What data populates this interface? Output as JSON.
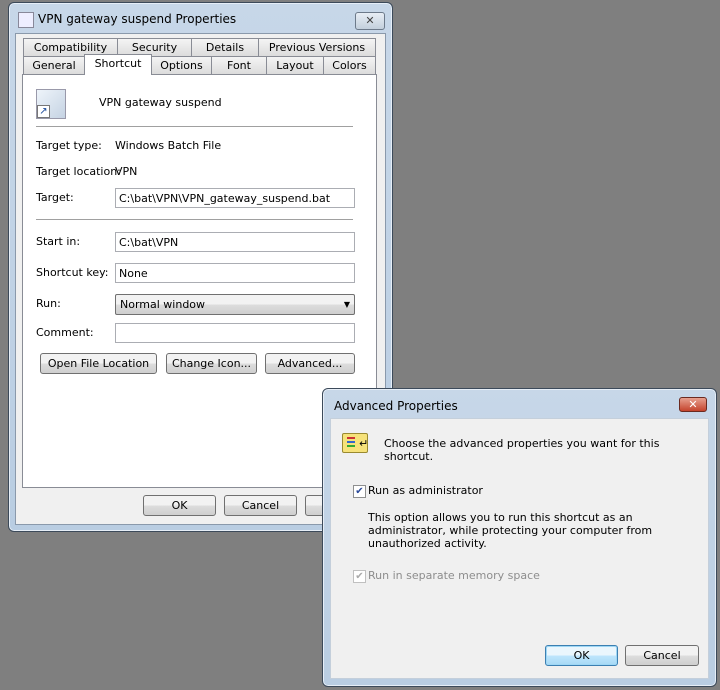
{
  "main_window": {
    "title": "VPN gateway suspend Properties",
    "tabs_row1": [
      "Compatibility",
      "Security",
      "Details",
      "Previous Versions"
    ],
    "tabs_row2": [
      "General",
      "Shortcut",
      "Options",
      "Font",
      "Layout",
      "Colors"
    ],
    "active_tab": "Shortcut",
    "shortcut_name": "VPN gateway suspend",
    "target_type_label": "Target type:",
    "target_type": "Windows Batch File",
    "target_location_label": "Target location:",
    "target_location": "VPN",
    "target_label": "Target:",
    "target": "C:\\bat\\VPN\\VPN_gateway_suspend.bat",
    "start_in_label": "Start in:",
    "start_in": "C:\\bat\\VPN",
    "shortcut_key_label": "Shortcut key:",
    "shortcut_key": "None",
    "run_label": "Run:",
    "run": "Normal window",
    "comment_label": "Comment:",
    "comment": "",
    "open_file_location": "Open File Location",
    "change_icon": "Change Icon...",
    "advanced": "Advanced...",
    "ok": "OK",
    "cancel": "Cancel"
  },
  "advanced_dialog": {
    "title": "Advanced Properties",
    "prompt": "Choose the advanced properties you want for this shortcut.",
    "run_as_admin": "Run as administrator",
    "run_as_admin_checked": true,
    "description_lines": [
      "This option allows you to run this shortcut as an",
      "administrator, while protecting your computer from",
      "unauthorized activity."
    ],
    "separate_memory": "Run in separate memory space",
    "separate_memory_checked": true,
    "separate_memory_enabled": false,
    "ok": "OK",
    "cancel": "Cancel"
  }
}
